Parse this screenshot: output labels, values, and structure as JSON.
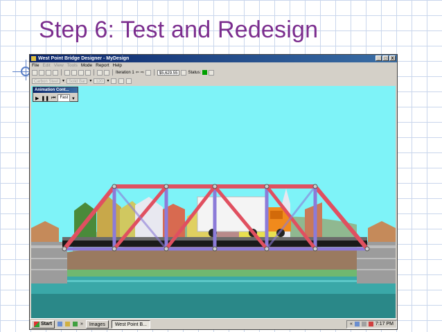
{
  "slide": {
    "title": "Step 6: Test and Redesign"
  },
  "window": {
    "title": "West Point Bridge Designer - MyDesign",
    "controls": [
      "_",
      "□",
      "X"
    ]
  },
  "menu": {
    "file": "File",
    "edit": "Edit",
    "view": "View",
    "tools": "Tools",
    "mode": "Mode",
    "report": "Report",
    "help": "Help"
  },
  "toolbar": {
    "iteration_label": "Iteration 1",
    "cost": "$5,629.55",
    "status_label": "Status:",
    "material": "Carbon Steel",
    "section": "Solid Bar",
    "size": "120"
  },
  "animation": {
    "title": "Animation Cont...",
    "play": "▶",
    "pause": "❚❚",
    "rewind": "⏮",
    "speed": "Fast"
  },
  "taskbar": {
    "start": "Start",
    "chevron": "»",
    "items": [
      "Images",
      "West Point B..."
    ],
    "tray_chevron": "«",
    "clock": "7:17 PM"
  },
  "colors": {
    "title_purple": "#7b2d8e",
    "sky": "#7ef3f8",
    "water": "#3aa8a8",
    "member_compression": "#e05060",
    "member_tension": "#8c7bd8",
    "truck_cargo": "#f4f4f4",
    "truck_cab": "#f08a1c"
  }
}
